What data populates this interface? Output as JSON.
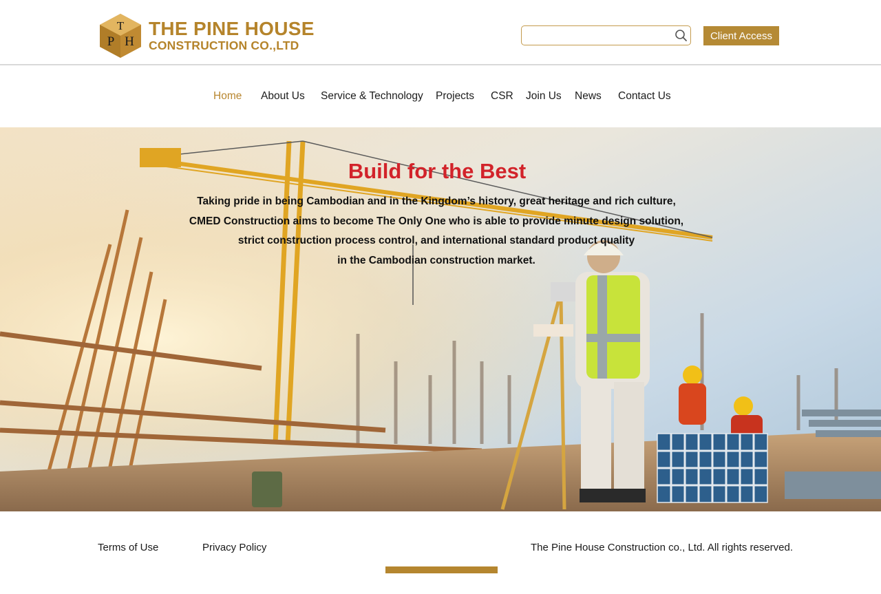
{
  "brand": {
    "logo_letters": [
      "T",
      "P",
      "H"
    ],
    "name_line1": "THE PINE HOUSE",
    "name_line2": "CONSTRUCTION CO.,LTD",
    "accent_color": "#b5842b"
  },
  "header": {
    "search": {
      "value": "",
      "placeholder": "",
      "icon": "search-icon"
    },
    "client_access_label": "Client Access"
  },
  "nav": {
    "items": [
      {
        "label": "Home",
        "active": true
      },
      {
        "label": "About Us",
        "active": false
      },
      {
        "label": "Service & Technology",
        "active": false
      },
      {
        "label": "Projects",
        "active": false
      },
      {
        "label": "CSR",
        "active": false
      },
      {
        "label": "Join Us",
        "active": false
      },
      {
        "label": "News",
        "active": false
      },
      {
        "label": "Contact Us",
        "active": false
      }
    ]
  },
  "hero": {
    "title": "Build for the Best",
    "title_color": "#d2232a",
    "lines": [
      "Taking pride in being Cambodian and in the Kingdom’s history, great heritage and rich culture,",
      "CMED Construction aims to become The Only One who is able to provide minute design solution,",
      "strict construction process control, and international standard product quality",
      "in the Cambodian construction market."
    ]
  },
  "footer": {
    "terms_label": "Terms of Use",
    "privacy_label": "Privacy Policy",
    "copyright": "The Pine House Construction co., Ltd. All rights reserved."
  }
}
